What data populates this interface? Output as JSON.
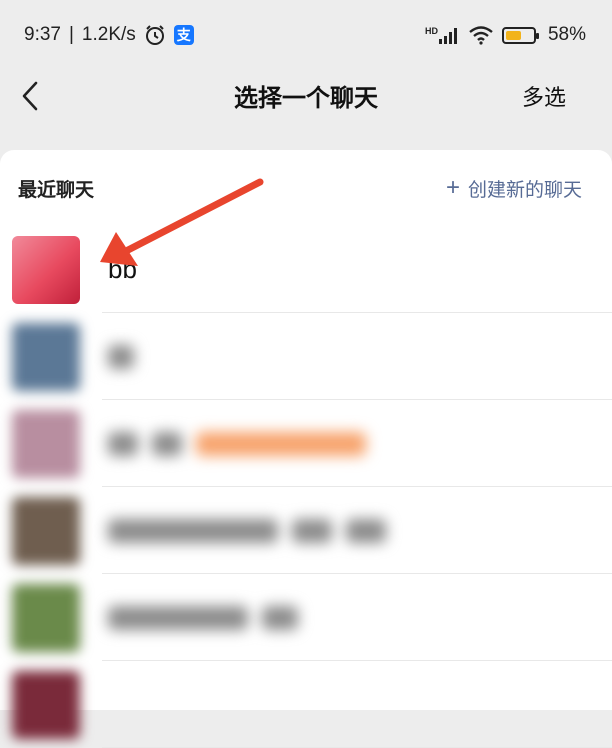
{
  "status_bar": {
    "time": "9:37",
    "network_speed": "1.2K/s",
    "separator": "|",
    "alarm_icon": "alarm-icon",
    "app_icon_text": "支",
    "hd_label": "HD",
    "battery_percent": "58%",
    "battery_level": 0.58,
    "battery_color": "#f2b31b"
  },
  "nav": {
    "back_icon": "chevron-left-icon",
    "title": "选择一个聊天",
    "multi_select": "多选"
  },
  "section": {
    "title": "最近聊天",
    "create_new": "创建新的聊天",
    "create_icon": "plus-icon"
  },
  "chats": [
    {
      "name": "bb",
      "avatar_color": "#e84a5f"
    },
    {
      "name": "",
      "avatar_color": "#5b7896"
    },
    {
      "name": "",
      "avatar_color": "#b88ea0"
    },
    {
      "name": "",
      "avatar_color": "#6f5e4f"
    },
    {
      "name": "",
      "avatar_color": "#6a8a4a"
    },
    {
      "name": "",
      "avatar_color": "#7a2a3a"
    }
  ],
  "colors": {
    "link": "#576b95",
    "annotation_arrow": "#e8452e"
  }
}
